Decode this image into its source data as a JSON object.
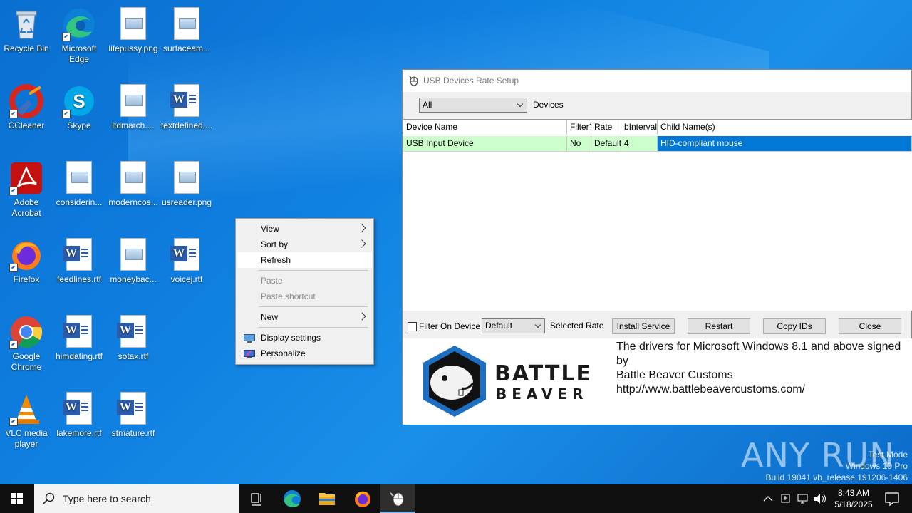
{
  "desktop": {
    "icons": [
      {
        "label": "Recycle Bin"
      },
      {
        "label": "Microsoft Edge"
      },
      {
        "label": "lifepussy.png"
      },
      {
        "label": "surfaceam..."
      },
      {
        "label": "CCleaner"
      },
      {
        "label": "Skype"
      },
      {
        "label": "ltdmarch...."
      },
      {
        "label": "textdefined...."
      },
      {
        "label": "Adobe Acrobat"
      },
      {
        "label": "considerin..."
      },
      {
        "label": "moderncos..."
      },
      {
        "label": "usreader.png"
      },
      {
        "label": "Firefox"
      },
      {
        "label": "feedlines.rtf"
      },
      {
        "label": "moneybac..."
      },
      {
        "label": "voicej.rtf"
      },
      {
        "label": "Google Chrome"
      },
      {
        "label": "himdating.rtf"
      },
      {
        "label": "sotax.rtf"
      },
      {
        "label": "VLC media player"
      },
      {
        "label": "lakemore.rtf"
      },
      {
        "label": "stmature.rtf"
      }
    ]
  },
  "context_menu": {
    "items": [
      {
        "label": "View"
      },
      {
        "label": "Sort by"
      },
      {
        "label": "Refresh"
      },
      {
        "label": "Paste"
      },
      {
        "label": "Paste shortcut"
      },
      {
        "label": "New"
      },
      {
        "label": "Display settings"
      },
      {
        "label": "Personalize"
      }
    ]
  },
  "app": {
    "title": "USB Devices Rate Setup",
    "filter_select": "All",
    "devices_label": "Devices",
    "columns": [
      "Device Name",
      "Filter?",
      "Rate",
      "bInterval",
      "Child Name(s)"
    ],
    "rows": [
      {
        "device_name": "USB Input Device",
        "filter": "No",
        "rate": "Default",
        "binterval": "4",
        "child_names": "HID-compliant mouse"
      }
    ],
    "filter_on_device_label": "Filter On Device",
    "rate_select": "Default",
    "selected_rate_label": "Selected Rate",
    "buttons": {
      "install_service": "Install Service",
      "restart": "Restart",
      "copy_ids": "Copy IDs",
      "close": "Close"
    },
    "logo": {
      "line1": "BATTLE",
      "line2": "BEAVER"
    },
    "info": {
      "line1": "The drivers for Microsoft Windows 8.1 and above signed by",
      "line2": "Battle Beaver Customs",
      "line3": "http://www.battlebeavercustoms.com/"
    }
  },
  "watermark": {
    "brand": "ANY RUN",
    "line1": "Test Mode",
    "line2": "Windows 10 Pro",
    "line3": "Build 19041.vb_release.191206-1406"
  },
  "taskbar": {
    "search_placeholder": "Type here to search",
    "time": "8:43 AM",
    "date": "5/18/2025"
  },
  "colors": {
    "accent": "#0078d7",
    "row_highlight": "#ccffcc"
  }
}
